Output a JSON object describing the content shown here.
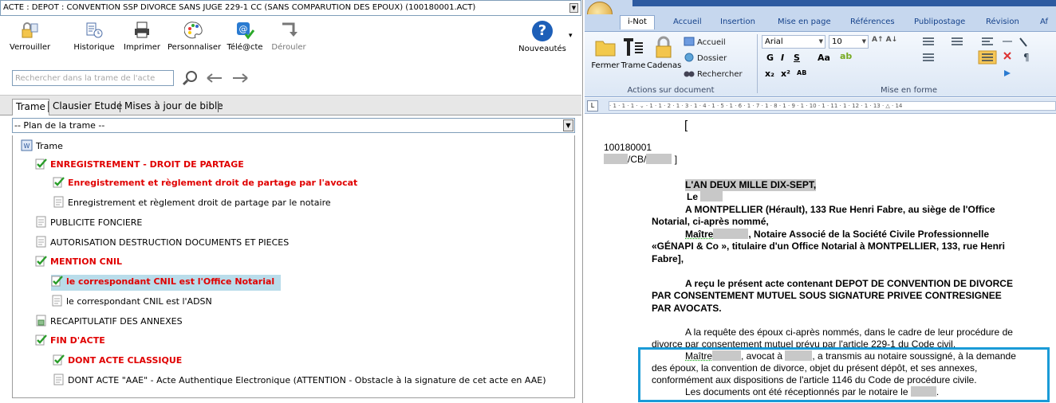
{
  "window": {
    "title": "ACTE : DEPOT : CONVENTION SSP DIVORCE SANS JUGE 229-1 CC (SANS COMPARUTION DES EPOUX) (100180001.ACT)"
  },
  "toolbar": {
    "verrouiller": "Verrouiller",
    "historique": "Historique",
    "imprimer": "Imprimer",
    "personnaliser": "Personnaliser",
    "teleacte": "Télé@cte",
    "derouler": "Dérouler",
    "nouveautes": "Nouveautés",
    "help_glyph": "?"
  },
  "search": {
    "placeholder": "Rechercher dans la trame de l'acte"
  },
  "tabs": [
    {
      "label": "Trame"
    },
    {
      "label": "Clausier Etude"
    },
    {
      "label": "Mises à jour de bible"
    }
  ],
  "plan_select": {
    "value": "-- Plan de la trame --"
  },
  "tree": [
    {
      "label": "Trame",
      "icon": "document-word-icon",
      "style": "normal"
    },
    {
      "label": "ENREGISTREMENT - DROIT DE PARTAGE",
      "icon": "checked-doc-icon",
      "style": "red"
    },
    {
      "label": "Enregistrement et règlement droit de partage par l'avocat",
      "icon": "checked-doc-icon",
      "style": "red"
    },
    {
      "label": "Enregistrement et règlement droit de partage par le notaire",
      "icon": "page-icon",
      "style": "normal"
    },
    {
      "label": "PUBLICITE FONCIERE",
      "icon": "page-icon",
      "style": "normal"
    },
    {
      "label": "AUTORISATION DESTRUCTION DOCUMENTS ET PIECES",
      "icon": "page-icon",
      "style": "normal"
    },
    {
      "label": "MENTION CNIL",
      "icon": "checked-doc-icon",
      "style": "red"
    },
    {
      "label": "le correspondant CNIL est l'Office Notarial",
      "icon": "checked-doc-icon",
      "style": "red-highlight"
    },
    {
      "label": "le correspondant CNIL est l'ADSN",
      "icon": "page-icon",
      "style": "normal"
    },
    {
      "label": "RECAPITULATIF DES ANNEXES",
      "icon": "table-icon",
      "style": "normal"
    },
    {
      "label": "FIN D'ACTE",
      "icon": "checked-doc-icon",
      "style": "red"
    },
    {
      "label": "DONT ACTE CLASSIQUE",
      "icon": "checked-doc-icon",
      "style": "red"
    },
    {
      "label": "DONT ACTE \"AAE\" - Acte Authentique Electronique (ATTENTION - Obstacle à la signature de cet acte en AAE)",
      "icon": "page-icon",
      "style": "normal"
    }
  ],
  "word": {
    "tabs": [
      "i-Not",
      "Accueil",
      "Insertion",
      "Mise en page",
      "Références",
      "Publipostage",
      "Révision",
      "Af"
    ],
    "group1": {
      "fermer": "Fermer",
      "trame": "Trame",
      "cadenas": "Cadenas",
      "accueil": "Accueil",
      "dossier": "Dossier",
      "rechercher": "Rechercher",
      "label": "Actions sur document"
    },
    "group2": {
      "font": "Arial",
      "size": "10",
      "label": "Mise en forme",
      "bold": "G",
      "italic": "I",
      "underline": "S",
      "case": "Aa",
      "sub": "x₂",
      "sup": "x²",
      "smallcaps": "AB"
    },
    "ruler_text": "· 1 · 1 · 1 · ⌄ · 1 · 1 · 2 · 1 · 3 · 1 · 4 · 1 · 5 · 1 · 6 · 1 · 7 · 1 · 8 · 1 · 9 · 1 · 10 · 1 · 11 · 1 · 12 · 1 · 13 · △ · 14",
    "ruler_tab": "L"
  },
  "doc": {
    "bracket_open": "[",
    "ref_number": "100180001",
    "ref_suffix": "/CB/",
    "bracket_close": "]",
    "year_line": "L'AN DEUX MILLE DIX-SEPT,",
    "le": "Le",
    "place_line1": "A MONTPELLIER (Hérault), 133 Rue Henri Fabre, au siège de l'Office",
    "place_line2": "Notarial, ci-après nommé,",
    "maitre_line1_a": "Maître",
    "maitre_line1_b": ", Notaire Associé de la Société Civile Professionnelle",
    "maitre_line2": "«GÉNAPI & Co », titulaire d'un Office Notarial à MONTPELLIER, 133, rue Henri",
    "maitre_line3": "Fabre",
    "recu_line1": "A reçu le présent acte contenant DEPOT DE CONVENTION DE DIVORCE",
    "recu_line2": "PAR CONSENTEMENT MUTUEL SOUS SIGNATURE PRIVEE CONTRESIGNEE",
    "recu_line3": "PAR AVOCATS.",
    "req_line1": "A la requête des époux ci-après nommés, dans le cadre de leur procédure de",
    "req_line2": "divorce par consentement mutuel prévu par l'article 229-1 du Code civil.",
    "box_line1_a": "Maître",
    "box_line1_b": ", avocat à",
    "box_line1_c": ", a transmis au notaire soussigné, à la demande",
    "box_line2": "des époux, la convention de divorce, objet du présent dépôt, et ses annexes,",
    "box_line3": "conformément aux dispositions de l'article 1146 du Code de procédure civile.",
    "box_line4_a": "Les documents ont été réceptionnés par le notaire le",
    "box_line4_b": "."
  }
}
